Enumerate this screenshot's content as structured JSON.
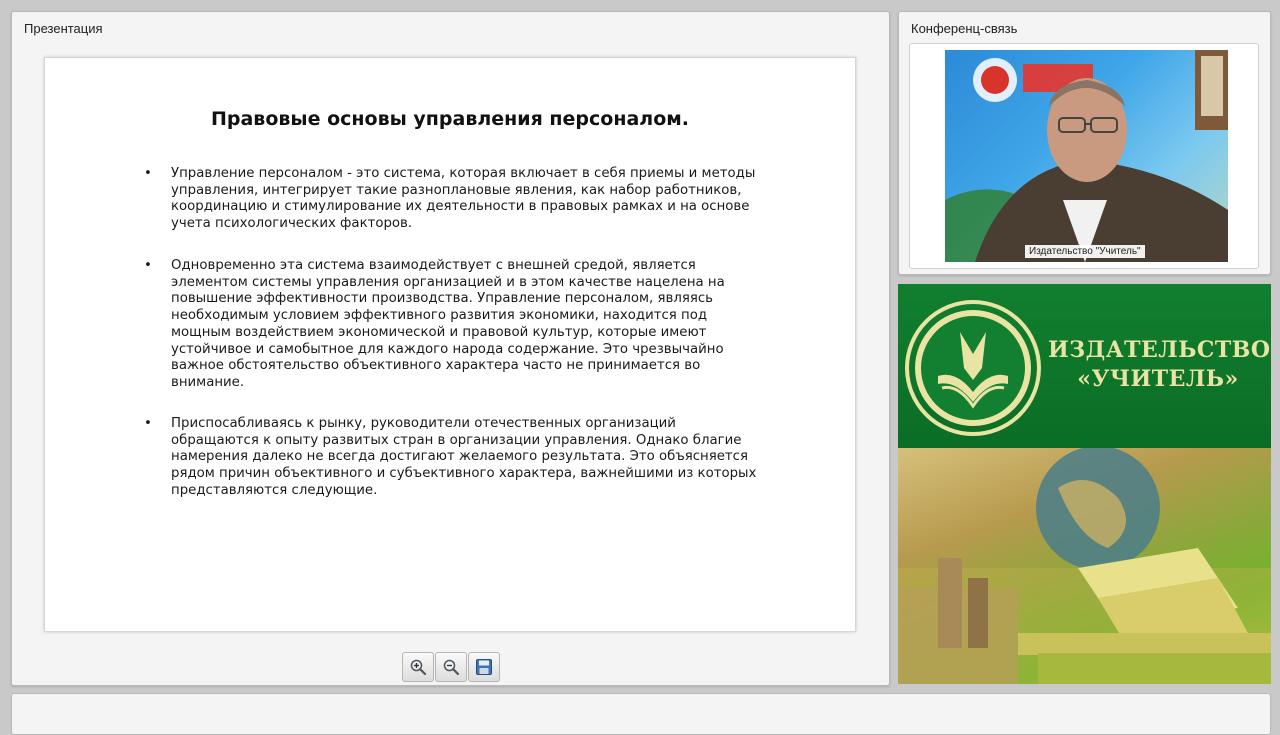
{
  "presentation": {
    "panel_title": "Презентация",
    "slide": {
      "title": "Правовые основы управления персоналом.",
      "bullet_symbol": "•",
      "bullets": [
        "Управление персоналом - это система, которая включает в себя приемы и методы управления, интегрирует такие разноплановые явления, как набор работников, координацию и стимулирование их деятельности в правовых рамках и на основе учета психологических факторов.",
        "Одновременно эта система взаимодействует с внешней средой, является элементом системы управления организацией и в этом качестве нацелена на повышение эффективности производства. Управление персоналом, являясь необходимым условием эффективного развития экономики, находится под мощным воздействием экономической и правовой культур, которые имеют устойчивое и самобытное для каждого народа содержание. Это чрезвычайно важное обстоятельство объективного характера часто не принимается во внимание.",
        "Приспосабливаясь к рынку, руководители отечественных организаций обращаются к опыту развитых стран в организации управления. Однако благие намерения далеко не всегда достигают желаемого результата. Это объясняется рядом причин объективного и субъективного характера, важнейшими из которых представляются следующие."
      ]
    },
    "toolbar": {
      "zoom_in_icon": "magnifier-plus-icon",
      "zoom_out_icon": "magnifier-minus-icon",
      "save_icon": "floppy-disk-icon"
    }
  },
  "conference": {
    "panel_title": "Конференц-связь",
    "video_label": "Издательство \"Учитель\""
  },
  "banner": {
    "brand_line1": "ИЗДАТЕЛЬСТВО",
    "brand_line2": "«УЧИТЕЛЬ»",
    "accent_color": "#117f2f",
    "text_color": "#e9e3a4"
  }
}
